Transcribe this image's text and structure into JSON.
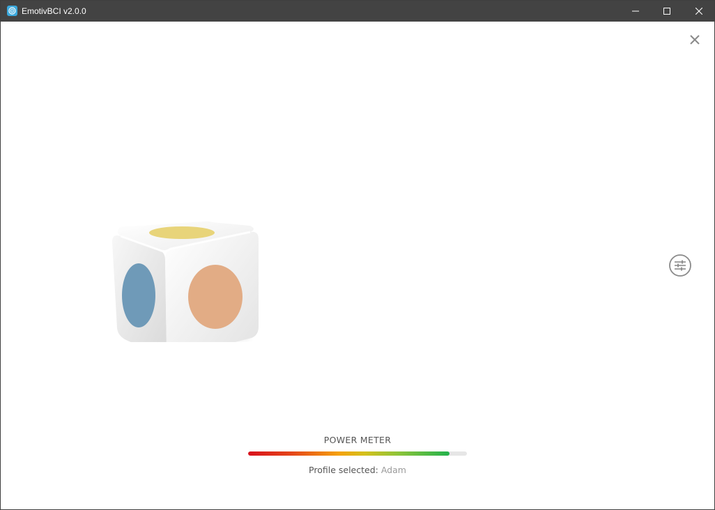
{
  "window": {
    "title": "EmotivBCI v2.0.0",
    "icons": {
      "app": "emotiv-logo-icon",
      "minimize": "minimize-icon",
      "maximize": "maximize-icon",
      "close": "close-icon"
    }
  },
  "panel": {
    "close_icon": "close-icon",
    "settings_icon": "sliders-settings-icon"
  },
  "cube": {
    "faces": {
      "top_color": "#e8d47a",
      "left_color": "#6f9ab8",
      "right_color": "#e2ac85"
    }
  },
  "power_meter": {
    "label": "POWER METER",
    "level_percent": 92,
    "colors": [
      "#d8111c",
      "#f5a10d",
      "#22b24c"
    ]
  },
  "profile": {
    "label": "Profile selected:",
    "value": "Adam"
  }
}
